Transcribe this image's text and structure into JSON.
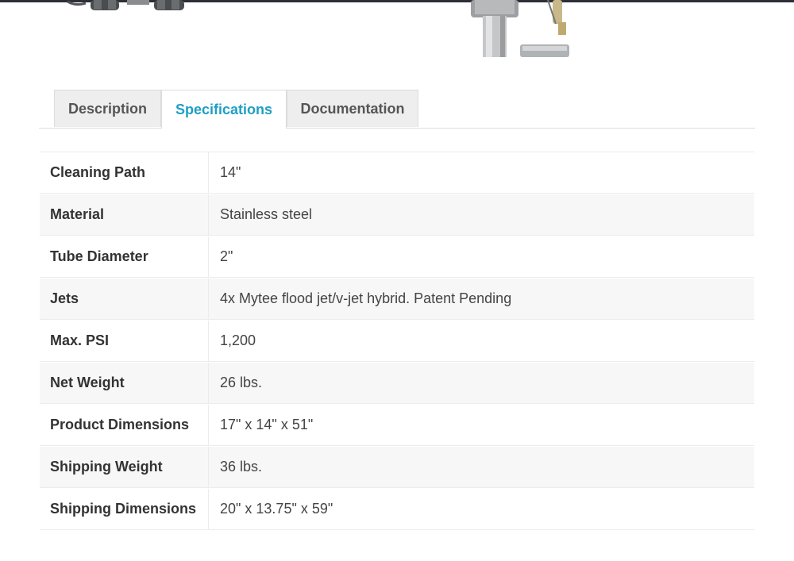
{
  "tabs": [
    {
      "label": "Description",
      "active": false
    },
    {
      "label": "Specifications",
      "active": true
    },
    {
      "label": "Documentation",
      "active": false
    }
  ],
  "colors": {
    "active_tab": "#1f9fc4",
    "inactive_tab_bg": "#eeeeef",
    "stripe_row_bg": "#f7f7f7"
  },
  "specifications": [
    {
      "key": "Cleaning Path",
      "value": "14\""
    },
    {
      "key": "Material",
      "value": "Stainless steel"
    },
    {
      "key": "Tube Diameter",
      "value": "2\""
    },
    {
      "key": "Jets",
      "value": "4x Mytee flood jet/v-jet hybrid. Patent Pending"
    },
    {
      "key": "Max. PSI",
      "value": "1,200"
    },
    {
      "key": "Net Weight",
      "value": "26 lbs."
    },
    {
      "key": "Product Dimensions",
      "value": "17\" x 14\" x 51\""
    },
    {
      "key": "Shipping Weight",
      "value": "36 lbs."
    },
    {
      "key": "Shipping Dimensions",
      "value": "20\" x 13.75\" x 59\""
    }
  ]
}
